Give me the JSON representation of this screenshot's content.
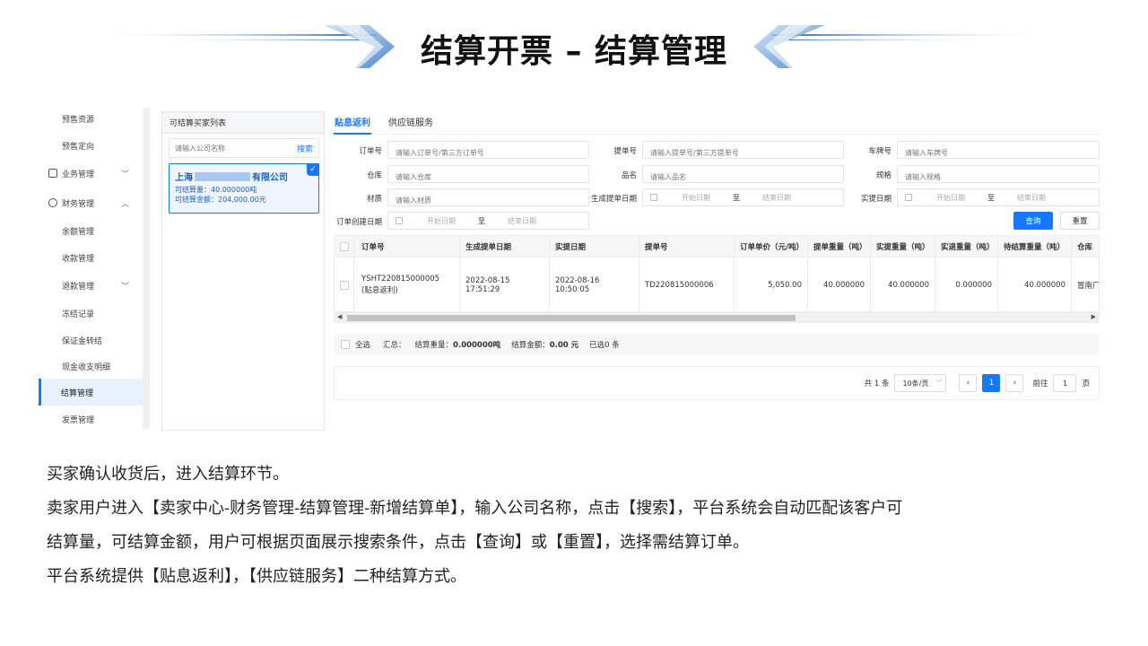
{
  "slide": {
    "title": "结算开票 – 结算管理"
  },
  "nav": {
    "items": [
      {
        "label": "预售资源",
        "type": "sub"
      },
      {
        "label": "预售定向",
        "type": "sub"
      },
      {
        "label": "业务管理",
        "type": "group",
        "icon": "folder-icon",
        "chevron": "﹀"
      },
      {
        "label": "财务管理",
        "type": "group",
        "icon": "finance-icon",
        "chevron": "︿"
      },
      {
        "label": "余额管理",
        "type": "sub"
      },
      {
        "label": "收款管理",
        "type": "sub"
      },
      {
        "label": "退款管理",
        "type": "sub",
        "chevron": "﹀"
      },
      {
        "label": "冻结记录",
        "type": "sub"
      },
      {
        "label": "保证金转结",
        "type": "sub"
      },
      {
        "label": "现金收支明细",
        "type": "sub"
      },
      {
        "label": "结算管理",
        "type": "sub",
        "active": true
      },
      {
        "label": "发票管理",
        "type": "sub"
      }
    ]
  },
  "buyer_panel": {
    "title": "可结算买家列表",
    "search_placeholder": "请输入公司名称",
    "search_button": "搜索",
    "card": {
      "name_prefix": "上海",
      "name_suffix": "有限公司",
      "qty": "可结算量：40.000000吨",
      "amount": "可结算金额：204,000.00元",
      "check": "✓"
    }
  },
  "tabs": [
    {
      "label": "贴息返利",
      "active": true
    },
    {
      "label": "供应链服务",
      "active": false
    }
  ],
  "filters": {
    "order_no": {
      "label": "订单号",
      "placeholder": "请输入订单号/第三方订单号"
    },
    "bill_no": {
      "label": "提单号",
      "placeholder": "请输入提单号/第三方提单号"
    },
    "plate_no": {
      "label": "车牌号",
      "placeholder": "请输入车牌号"
    },
    "warehouse": {
      "label": "仓库",
      "placeholder": "请输入仓库"
    },
    "product": {
      "label": "品名",
      "placeholder": "请输入品名"
    },
    "spec": {
      "label": "规格",
      "placeholder": "请输入规格"
    },
    "material": {
      "label": "材质",
      "placeholder": "请输入材质"
    },
    "bill_date": {
      "label": "生成提单日期",
      "start": "开始日期",
      "to": "至",
      "end": "结束日期"
    },
    "pick_date": {
      "label": "实提日期",
      "start": "开始日期",
      "to": "至",
      "end": "结束日期"
    },
    "order_date": {
      "label": "订单创建日期",
      "start": "开始日期",
      "to": "至",
      "end": "结束日期"
    },
    "query_button": "查询",
    "reset_button": "重置"
  },
  "table": {
    "headers": [
      "订单号",
      "生成提单日期",
      "实提日期",
      "提单号",
      "订单单价（元/吨）",
      "提单重量（吨）",
      "实提重量（吨）",
      "实退重量（吨）",
      "待结算重量（吨）",
      "仓库"
    ],
    "rows": [
      {
        "order_no": "YSHT220815000005",
        "order_tag": "(贴息返利)",
        "bill_date": "2022-08-15 17:51:29",
        "pick_date": "2022-08-16 10:50:05",
        "bill_no": "TD220815000006",
        "price": "5,050.00",
        "bill_weight": "40.000000",
        "pick_weight": "40.000000",
        "return_weight": "0.000000",
        "pending_weight": "40.000000",
        "warehouse": "冒南厂"
      }
    ]
  },
  "summary": {
    "select_all": "全选",
    "total_label": "汇总：",
    "weight_label": "结算重量：",
    "weight_value": "0.000000吨",
    "amount_label": "结算金额：",
    "amount_value": "0.00 元",
    "selected": "已选0 条"
  },
  "pager": {
    "total": "共 1 条",
    "page_size": "10条/页",
    "prev": "‹",
    "current": "1",
    "next": "›",
    "goto_label": "前往",
    "goto_value": "1",
    "page_unit": "页"
  },
  "description": [
    "买家确认收货后，进入结算环节。",
    "卖家用户进入【卖家中心-财务管理-结算管理-新增结算单】，输入公司名称，点击【搜索】，平台系统会自动匹配该客户可",
    "结算量，可结算金额，用户可根据页面展示搜索条件，点击【查询】或【重置】，选择需结算订单。",
    "平台系统提供【贴息返利】，【供应链服务】二种结算方式。"
  ],
  "colors": {
    "accent": "#1677ff",
    "nav_active_bg": "#e8f1fc"
  }
}
